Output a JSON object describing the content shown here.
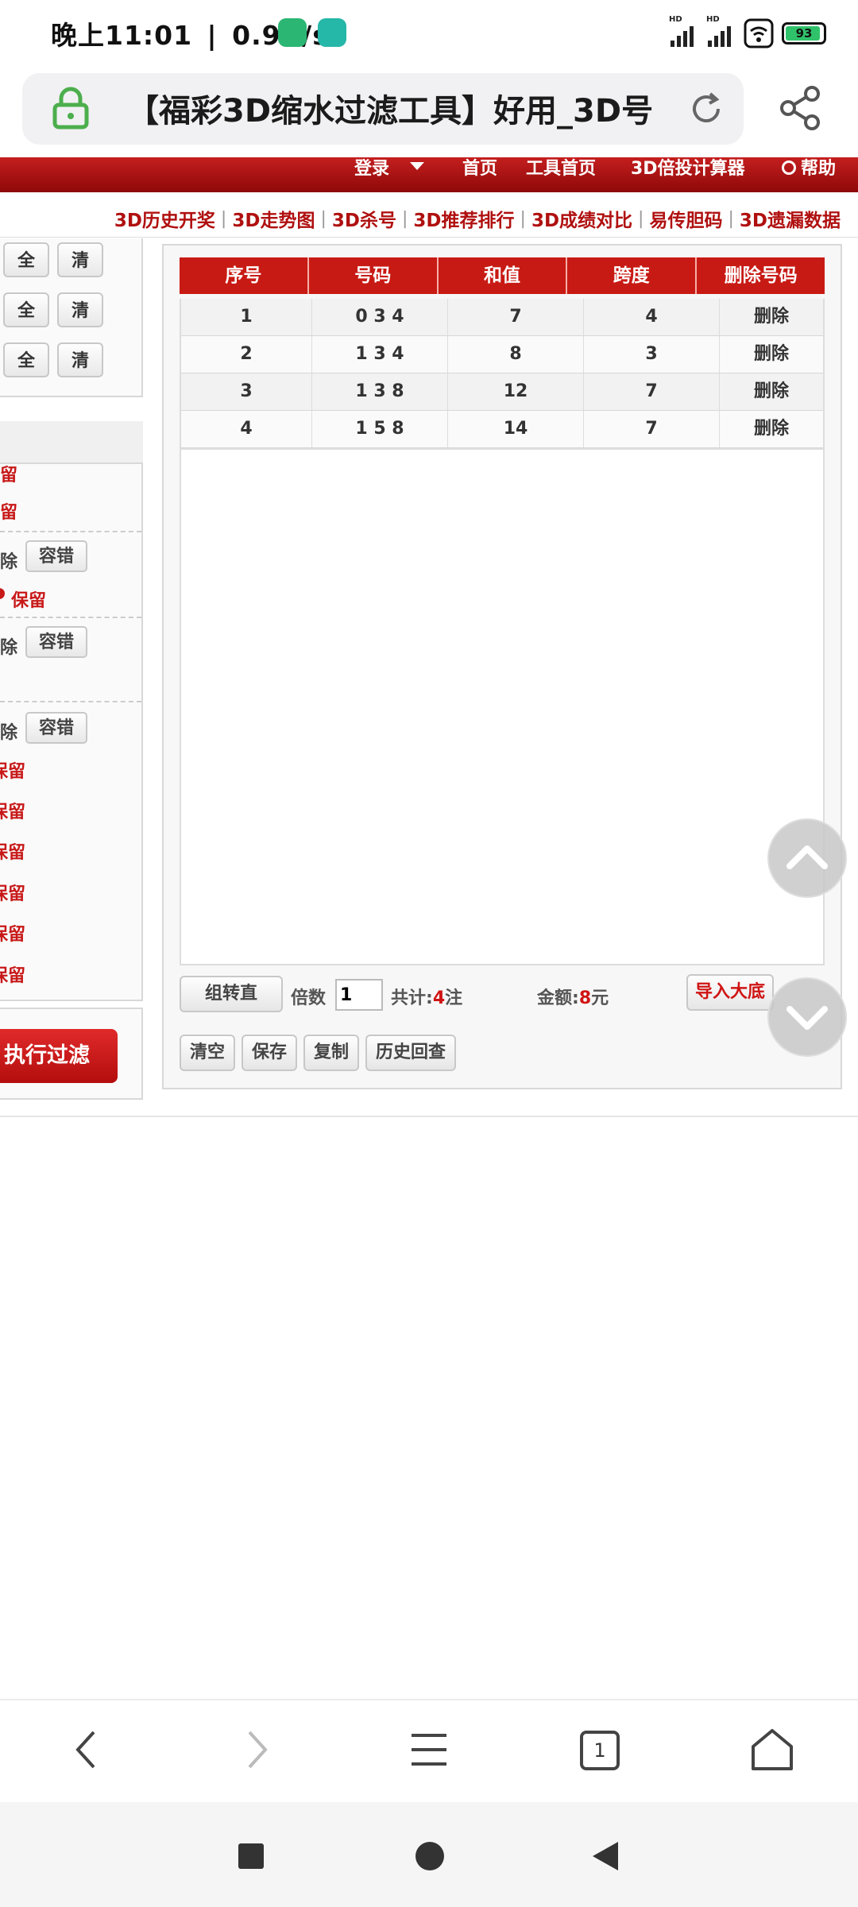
{
  "status_bar": {
    "time": "晚上11:01",
    "net_speed": "0.9K/s",
    "battery": "93",
    "battery_level": 0.93,
    "signal_label": "HD"
  },
  "browser": {
    "title": "【福彩3D缩水过滤工具】好用_3D号",
    "tab_count": "1"
  },
  "site_header": {
    "login": "登录",
    "home": "首页",
    "tools_home": "工具首页",
    "multiplier_calc": "3D倍投计算器",
    "help": "帮助"
  },
  "sub_nav": [
    "3D历史开奖",
    "3D走势图",
    "3D杀号",
    "3D推荐排行",
    "3D成绩对比",
    "易传胆码",
    "3D遗漏数据"
  ],
  "left_panel": {
    "all_label": "全",
    "clear_label": "清",
    "keep_label": "保留",
    "keep_label_fragment": "留",
    "remove_fragment": "除",
    "tolerance_label": "容错",
    "execute_label": "执行过滤"
  },
  "result_table": {
    "columns": [
      "序号",
      "号码",
      "和值",
      "跨度",
      "删除号码"
    ],
    "rows": [
      {
        "index": "1",
        "number": "0 3 4",
        "sum": "7",
        "span": "4",
        "action": "删除"
      },
      {
        "index": "2",
        "number": "1 3 4",
        "sum": "8",
        "span": "3",
        "action": "删除"
      },
      {
        "index": "3",
        "number": "1 3 8",
        "sum": "12",
        "span": "7",
        "action": "删除"
      },
      {
        "index": "4",
        "number": "1 5 8",
        "sum": "14",
        "span": "7",
        "action": "删除"
      }
    ]
  },
  "toolbar": {
    "convert_label": "组转直",
    "multiplier_label": "倍数",
    "multiplier_value": "1",
    "total_prefix": "共计:",
    "total_count": "4",
    "total_suffix": "注",
    "amount_prefix": "金额:",
    "amount_value": "8",
    "amount_suffix": "元",
    "import_label": "导入大底",
    "clear_label": "清空",
    "save_label": "保存",
    "copy_label": "复制",
    "history_label": "历史回查"
  },
  "colors": {
    "brand_red": "#c81a14",
    "header_dark_red": "#8e0808",
    "keep_red": "#c81818",
    "battery_green": "#30c26a"
  },
  "icons": {
    "lock": "lock-icon",
    "refresh": "refresh-icon",
    "share": "share-icon",
    "back": "back-icon",
    "forward": "forward-icon",
    "menu": "menu-icon",
    "tabs": "tabs-icon",
    "home": "home-icon"
  }
}
